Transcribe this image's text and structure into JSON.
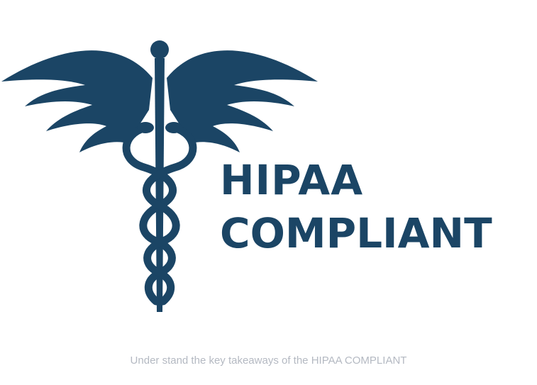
{
  "logo": {
    "icon": "caduceus-icon",
    "line1": "HIPAA",
    "line2": "COMPLIANT",
    "color": "#1b4565"
  },
  "caption": "Under stand the key takeaways of the HIPAA COMPLIANT",
  "colors": {
    "background": "#ffffff",
    "caption": "#b4b9c2"
  }
}
